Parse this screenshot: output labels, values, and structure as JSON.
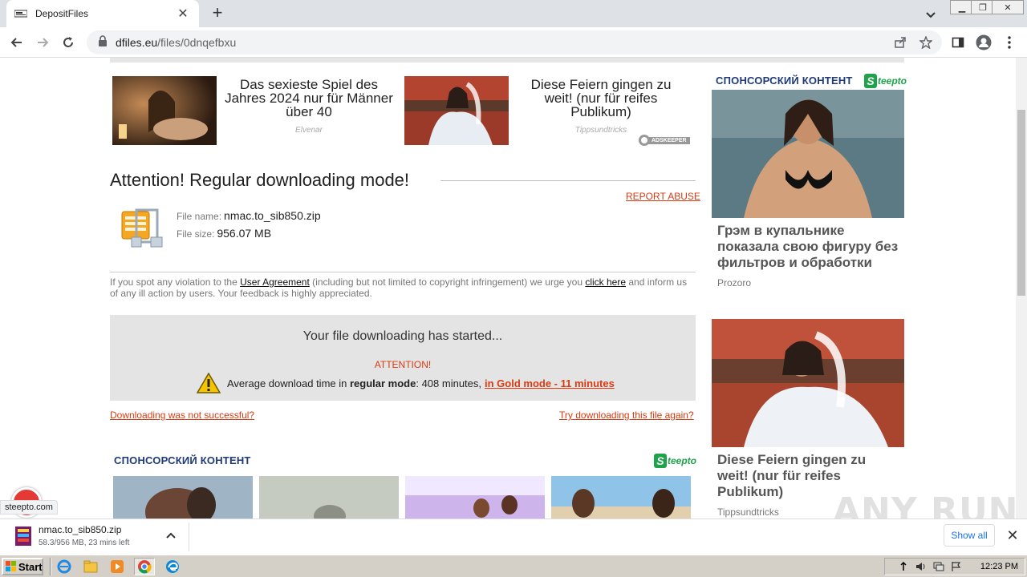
{
  "browser": {
    "tab_title": "DepositFiles",
    "new_tab": "+",
    "close_tab": "✕",
    "url_host": "dfiles.eu",
    "url_path": "/files/0dnqefbxu"
  },
  "top_ads": [
    {
      "text": "Das sexieste Spiel des Jahres 2024 nur für Männer über 40",
      "source": "Elvenar"
    },
    {
      "text": "Diese Feiern gingen zu weit! (nur für reifes Publikum)",
      "source": "Tippsundtricks"
    }
  ],
  "adskeeper_label": "ADSKEEPER",
  "main": {
    "heading": "Attention! Regular downloading mode!",
    "report_abuse": "REPORT ABUSE",
    "file_name_label": "File name:",
    "file_name": "nmac.to_sib850.zip",
    "file_size_label": "File size:",
    "file_size": "956.07 MB",
    "notice_1": "If you spot any violation to the ",
    "notice_link_1": "User Agreement",
    "notice_2": " (including but not limited to copyright infringement) we urge you ",
    "notice_link_2": "click here",
    "notice_3": " and inform us of any ill action by users. Your feedback is highly appreciated."
  },
  "download_box": {
    "started": "Your file downloading has started...",
    "attention": "ATTENTION!",
    "avg_1": "Average download time in ",
    "avg_bold": "regular mode",
    "avg_2": ": 408 minutes, ",
    "gold": "in Gold mode - 11 minutes"
  },
  "links": {
    "not_successful": "Downloading was not successful?",
    "try_again": "Try downloading this file again?"
  },
  "sponsored": {
    "heading": "СПОНСОРСКИЙ КОНТЕНТ",
    "brand_s": "S",
    "brand_rest": "teepto"
  },
  "side_cards": [
    {
      "title": "Грэм в купальнике показала свою фигуру без фильтров и обработки",
      "source": "Prozoro"
    },
    {
      "title": "Diese Feiern gingen zu weit! (nur für reifes Publikum)",
      "source": "Tippsundtricks"
    }
  ],
  "status_url": "steepto.com",
  "download_shelf": {
    "file": "nmac.to_sib850.zip",
    "progress": "58.3/956 MB, 23 mins left",
    "show_all": "Show all",
    "close": "✕"
  },
  "watermark": "ANY RUN",
  "taskbar": {
    "start": "Start",
    "clock": "12:23 PM"
  }
}
